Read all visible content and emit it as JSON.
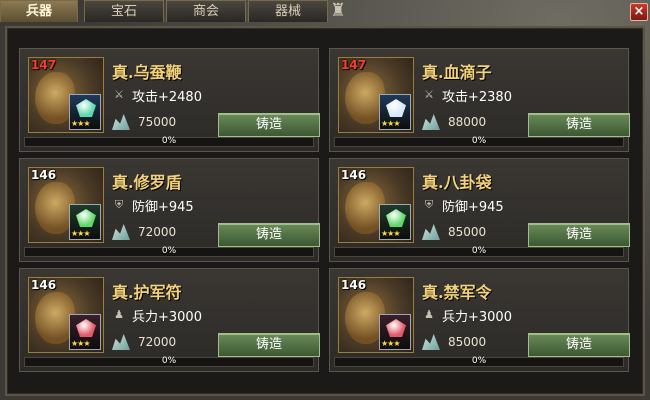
{
  "window": {
    "tabs": [
      {
        "label": "兵器",
        "active": true
      },
      {
        "label": "宝石",
        "active": false
      },
      {
        "label": "商会",
        "active": false
      },
      {
        "label": "器械",
        "active": false
      }
    ],
    "close_icon": "close-icon"
  },
  "items": [
    {
      "level": "147",
      "level_color": "#ff3b2a",
      "name": "真.乌蚕鞭",
      "stat_icon": "sword-icon",
      "stat": "攻击+2480",
      "cost": "75000",
      "forge_label": "铸造",
      "progress": 0,
      "progress_label": "0%",
      "gem_color": "#5fd8b0",
      "gem_slot_color": "#1f3a5a"
    },
    {
      "level": "147",
      "level_color": "#ff3b2a",
      "name": "真.血滴子",
      "stat_icon": "sword-icon",
      "stat": "攻击+2380",
      "cost": "88000",
      "forge_label": "铸造",
      "progress": 0,
      "progress_label": "0%",
      "gem_color": "#d8e8f5",
      "gem_slot_color": "#1f3a5a"
    },
    {
      "level": "146",
      "level_color": "#ffffff",
      "name": "真.修罗盾",
      "stat_icon": "shield-icon",
      "stat": "防御+945",
      "cost": "72000",
      "forge_label": "铸造",
      "progress": 0,
      "progress_label": "0%",
      "gem_color": "#5fd86a",
      "gem_slot_color": "#1f3a2a"
    },
    {
      "level": "146",
      "level_color": "#ffffff",
      "name": "真.八卦袋",
      "stat_icon": "shield-icon",
      "stat": "防御+945",
      "cost": "85000",
      "forge_label": "铸造",
      "progress": 0,
      "progress_label": "0%",
      "gem_color": "#5fd86a",
      "gem_slot_color": "#1f3a2a"
    },
    {
      "level": "146",
      "level_color": "#ffffff",
      "name": "真.护军符",
      "stat_icon": "soldier-icon",
      "stat": "兵力+3000",
      "cost": "72000",
      "forge_label": "铸造",
      "progress": 0,
      "progress_label": "0%",
      "gem_color": "#e05a6a",
      "gem_slot_color": "#3a1f2a"
    },
    {
      "level": "146",
      "level_color": "#ffffff",
      "name": "真.禁军令",
      "stat_icon": "soldier-icon",
      "stat": "兵力+3000",
      "cost": "85000",
      "forge_label": "铸造",
      "progress": 0,
      "progress_label": "0%",
      "gem_color": "#e05a6a",
      "gem_slot_color": "#3a1f2a"
    }
  ]
}
